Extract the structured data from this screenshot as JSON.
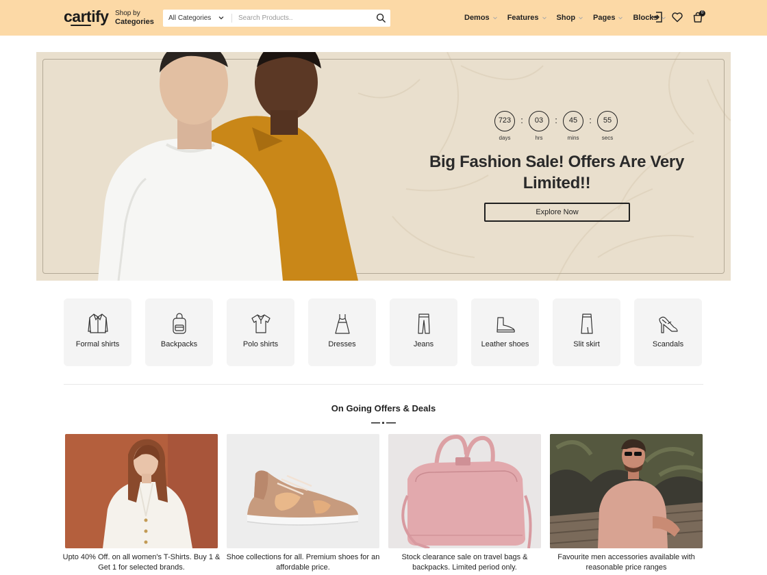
{
  "header": {
    "logo": "cartify",
    "shop_by_line1": "Shop by",
    "shop_by_line2": "Categories",
    "category_select": "All Categories",
    "search_placeholder": "Search Products..",
    "nav": [
      {
        "label": "Demos"
      },
      {
        "label": "Features"
      },
      {
        "label": "Shop"
      },
      {
        "label": "Pages"
      },
      {
        "label": "Blocks"
      }
    ],
    "cart_count": "0",
    "icons": [
      "login-icon",
      "heart-icon",
      "cart-icon"
    ]
  },
  "hero": {
    "countdown": [
      {
        "value": "723",
        "label": "days"
      },
      {
        "value": "03",
        "label": "hrs"
      },
      {
        "value": "45",
        "label": "mins"
      },
      {
        "value": "55",
        "label": "secs"
      }
    ],
    "separator": ":",
    "title": "Big Fashion Sale! Offers Are Very Limited!!",
    "cta": "Explore Now",
    "bg_color": "#e9dfcd"
  },
  "categories": [
    {
      "label": "Formal shirts",
      "icon": "formal-shirt-icon"
    },
    {
      "label": "Backpacks",
      "icon": "backpack-icon"
    },
    {
      "label": "Polo shirts",
      "icon": "polo-shirt-icon"
    },
    {
      "label": "Dresses",
      "icon": "dress-icon"
    },
    {
      "label": "Jeans",
      "icon": "jeans-icon"
    },
    {
      "label": "Leather shoes",
      "icon": "leather-shoe-icon"
    },
    {
      "label": "Slit skirt",
      "icon": "skirt-icon"
    },
    {
      "label": "Scandals",
      "icon": "sandal-icon"
    }
  ],
  "offers_section": {
    "title": "On Going Offers & Deals",
    "items": [
      {
        "text": "Upto 40% Off. on all women's T-Shirts. Buy 1 & Get 1 for selected brands."
      },
      {
        "text": "Shoe collections for all. Premium shoes for an affordable price."
      },
      {
        "text": "Stock clearance sale on travel bags & backpacks. Limited period only."
      },
      {
        "text": "Favourite men accessories available with reasonable price ranges"
      }
    ]
  },
  "colors": {
    "header_bg": "#fcd9a6",
    "accent_dark": "#1f1f1f",
    "tile_bg": "#f4f4f4"
  }
}
